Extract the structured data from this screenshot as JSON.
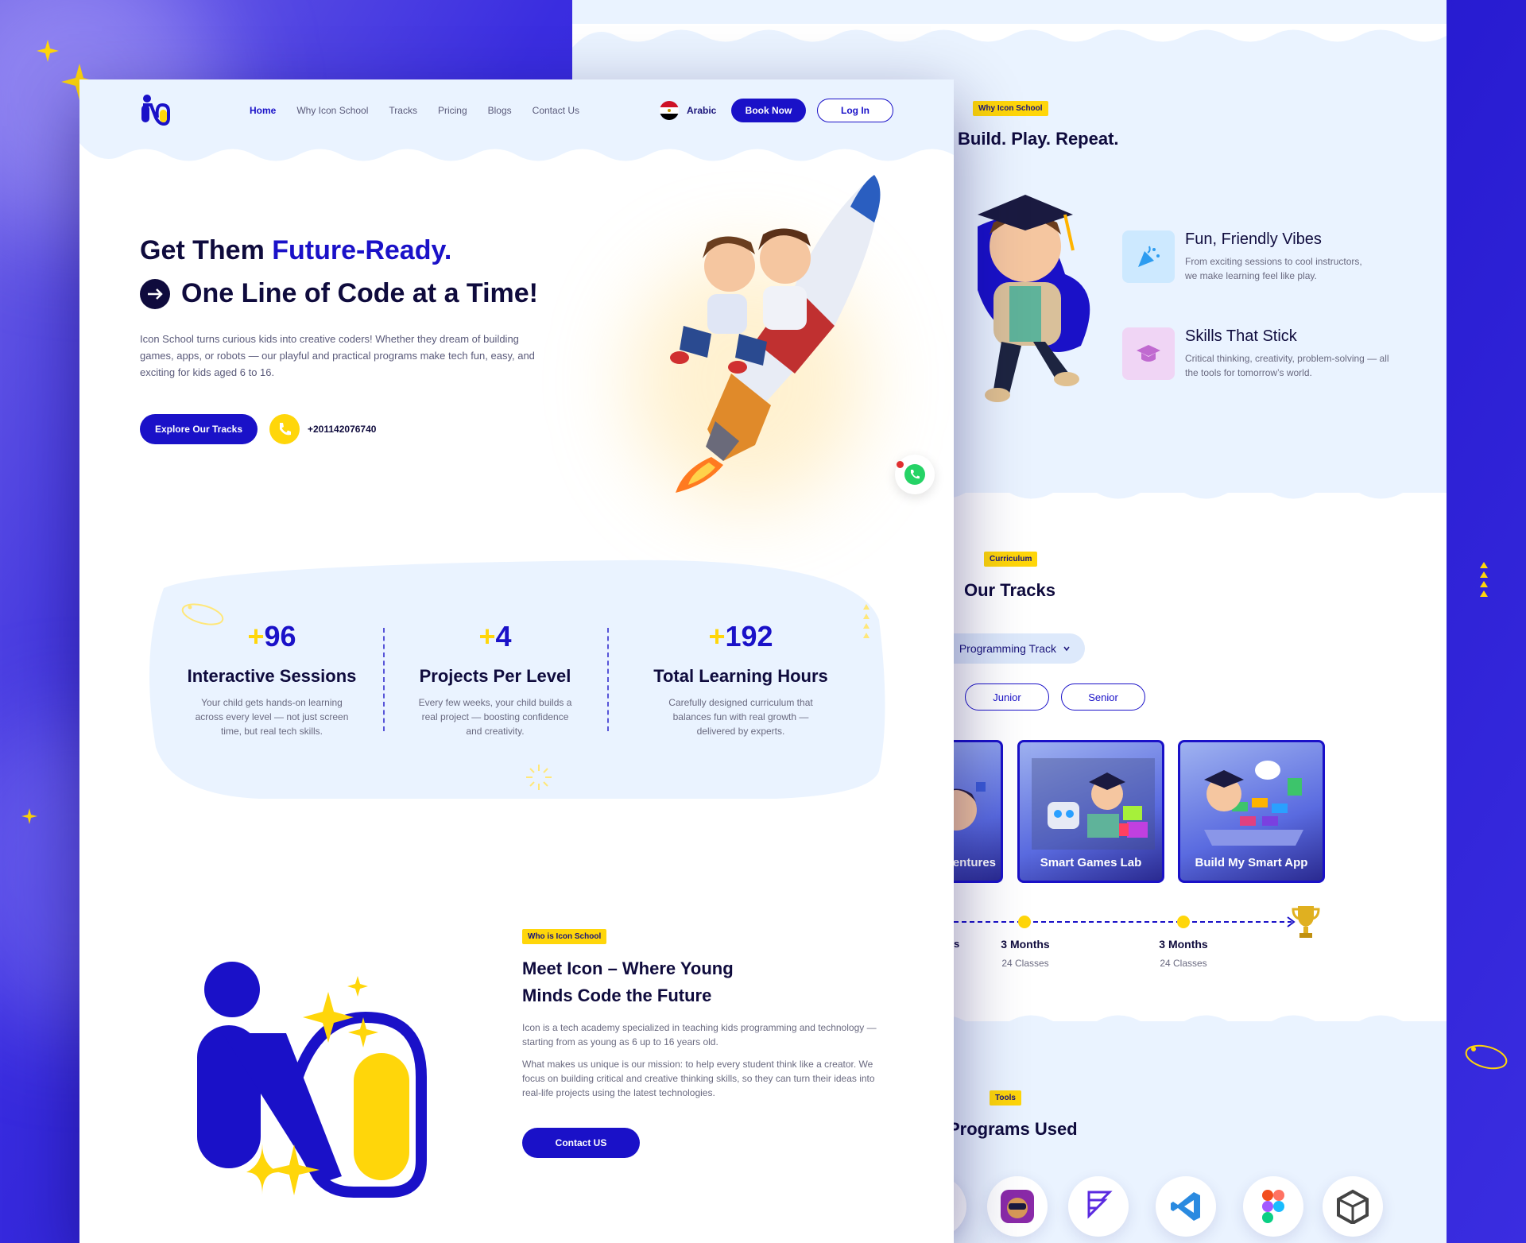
{
  "nav": {
    "items": [
      "Home",
      "Why Icon School",
      "Tracks",
      "Pricing",
      "Blogs",
      "Contact Us"
    ],
    "language": "Arabic",
    "book_now": "Book Now",
    "login": "Log In"
  },
  "hero": {
    "title_part1": "Get Them ",
    "title_highlight": "Future-Ready.",
    "title_line2": "One Line of Code at a Time!",
    "description": "Icon School turns curious kids into creative coders! Whether they dream of building games, apps, or robots — our playful and practical programs make tech fun, easy, and exciting for kids aged 6 to 16.",
    "cta": "Explore Our Tracks",
    "phone": "+201142076740"
  },
  "stats": [
    {
      "plus": "+",
      "value": "96",
      "title": "Interactive Sessions",
      "desc": "Your child gets hands-on learning across every level — not just screen time, but real tech skills."
    },
    {
      "plus": "+",
      "value": "4",
      "title": "Projects Per Level",
      "desc": "Every few weeks, your child builds a real project — boosting confidence and creativity."
    },
    {
      "plus": "+",
      "value": "192",
      "title": "Total Learning Hours",
      "desc": "Carefully designed curriculum that balances fun with real growth — delivered by experts."
    }
  ],
  "about": {
    "tag": "Who is Icon School",
    "title_line1": "Meet Icon – Where Young",
    "title_line2": "Minds Code the Future",
    "para1": "Icon is a tech academy specialized in teaching kids programming and technology — starting from as young as 6 up to 16 years old.",
    "para2": "What makes us unique is our mission: to help every student think like a creator. We focus on building critical and creative thinking skills, so they can turn their ideas into real-life projects using the latest technologies.",
    "cta": "Contact US"
  },
  "why": {
    "tag": "Why Icon School",
    "title": "Build. Play. Repeat.",
    "features": [
      {
        "title": "Fun, Friendly Vibes",
        "desc": "From exciting sessions to cool instructors, we make learning feel like play."
      },
      {
        "title": "Skills That Stick",
        "desc": "Critical thinking, creativity, problem-solving — all the tools for tomorrow’s world."
      }
    ]
  },
  "tracks": {
    "tag": "Curriculum",
    "title": "Our Tracks",
    "dropdown": "Programming Track",
    "levels": [
      "Junior",
      "Senior"
    ],
    "cards": [
      "entures",
      "Smart Games Lab",
      "Build My Smart App"
    ],
    "timeline": [
      {
        "duration": "3 Months",
        "classes": "24 Classes"
      },
      {
        "duration": "3 Months",
        "classes": "24 Classes"
      }
    ],
    "timeline_partial": "s"
  },
  "tools": {
    "tag": "Tools",
    "title": "Programs Used"
  },
  "colors": {
    "primary": "#1a11c8",
    "accent": "#ffd60a",
    "ink": "#0f0b3d",
    "light": "#eaf3ff"
  }
}
